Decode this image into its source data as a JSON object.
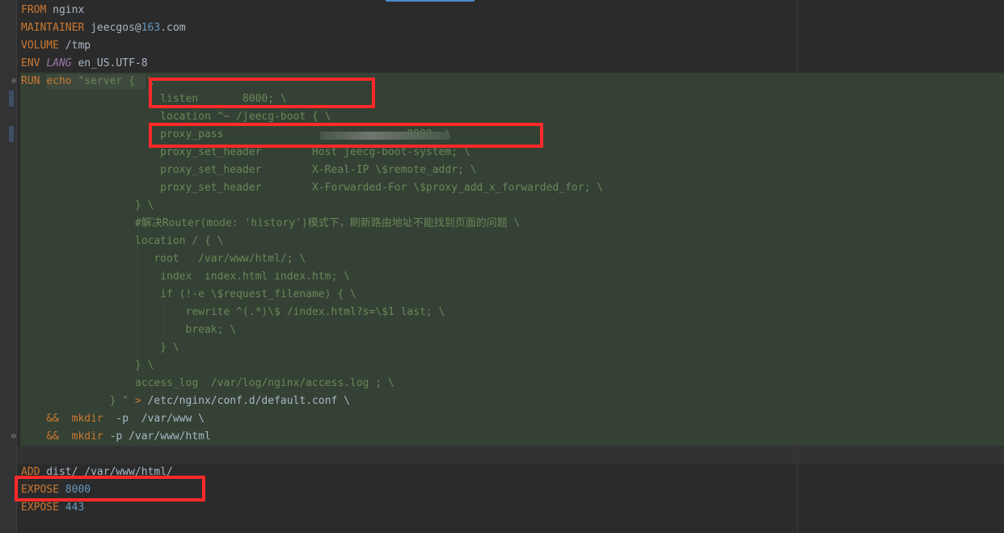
{
  "editor": {
    "lines": [
      {
        "t": [
          {
            "c": "kw",
            "v": "FROM"
          },
          {
            "c": "txt",
            "v": " nginx"
          }
        ]
      },
      {
        "t": [
          {
            "c": "kw",
            "v": "MAINTAINER"
          },
          {
            "c": "txt",
            "v": " jeecgos@"
          },
          {
            "c": "num",
            "v": "163"
          },
          {
            "c": "txt",
            "v": ".com"
          }
        ]
      },
      {
        "t": [
          {
            "c": "kw",
            "v": "VOLUME"
          },
          {
            "c": "txt",
            "v": " /tmp"
          }
        ]
      },
      {
        "t": [
          {
            "c": "kw",
            "v": "ENV"
          },
          {
            "c": "txt",
            "v": " "
          },
          {
            "c": "it",
            "v": "LANG"
          },
          {
            "c": "txt",
            "v": " en_US.UTF-8"
          }
        ]
      },
      {
        "t": [
          {
            "c": "kw",
            "v": "RUN"
          },
          {
            "c": "txt",
            "v": " "
          },
          {
            "c": "kw",
            "v": "echo"
          },
          {
            "c": "str",
            "v": " \"server {  \\"
          }
        ]
      },
      {
        "t": [
          {
            "c": "str",
            "v": "                      listen       8000; \\"
          }
        ]
      },
      {
        "t": [
          {
            "c": "str",
            "v": "                      location ^~ /jeecg-boot { \\"
          }
        ]
      },
      {
        "t": [
          {
            "c": "str",
            "v": "                      proxy_pass                            :9999; \\"
          }
        ]
      },
      {
        "t": [
          {
            "c": "str",
            "v": "                      proxy_set_header        Host jeecg-boot-system; \\"
          }
        ]
      },
      {
        "t": [
          {
            "c": "str",
            "v": "                      proxy_set_header        X-Real-IP \\$remote_addr; \\"
          }
        ]
      },
      {
        "t": [
          {
            "c": "str",
            "v": "                      proxy_set_header        X-Forwarded-For \\$proxy_add_x_forwarded_for; \\"
          }
        ]
      },
      {
        "t": [
          {
            "c": "str",
            "v": "                  } \\"
          }
        ]
      },
      {
        "t": [
          {
            "c": "str",
            "v": "                  #解决Router(mode: 'history')模式下，刷新路由地址不能找到页面的问题 \\"
          }
        ]
      },
      {
        "t": [
          {
            "c": "str",
            "v": "                  location / { \\"
          }
        ]
      },
      {
        "t": [
          {
            "c": "str",
            "v": "                     root   /var/www/html/; \\"
          }
        ]
      },
      {
        "t": [
          {
            "c": "str",
            "v": "                      index  index.html index.htm; \\"
          }
        ]
      },
      {
        "t": [
          {
            "c": "str",
            "v": "                      if (!-e \\$request_filename) { \\"
          }
        ]
      },
      {
        "t": [
          {
            "c": "str",
            "v": "                          rewrite ^(.*)\\$ /index.html?s=\\$1 last; \\"
          }
        ]
      },
      {
        "t": [
          {
            "c": "str",
            "v": "                          break; \\"
          }
        ]
      },
      {
        "t": [
          {
            "c": "str",
            "v": "                      } \\"
          }
        ]
      },
      {
        "t": [
          {
            "c": "str",
            "v": "                  } \\"
          }
        ]
      },
      {
        "t": [
          {
            "c": "str",
            "v": "                  access_log  /var/log/nginx/access.log ; \\"
          }
        ]
      },
      {
        "t": [
          {
            "c": "str",
            "v": "              } \" "
          },
          {
            "c": "kw",
            "v": ">"
          },
          {
            "c": "txt",
            "v": " /etc/nginx/conf.d/default.conf \\"
          }
        ]
      },
      {
        "t": [
          {
            "c": "txt",
            "v": "    "
          },
          {
            "c": "kw",
            "v": "&&"
          },
          {
            "c": "txt",
            "v": "  "
          },
          {
            "c": "kw",
            "v": "mkdir"
          },
          {
            "c": "txt",
            "v": "  -p  /var/www \\"
          }
        ]
      },
      {
        "t": [
          {
            "c": "txt",
            "v": "    "
          },
          {
            "c": "kw",
            "v": "&&"
          },
          {
            "c": "txt",
            "v": "  "
          },
          {
            "c": "kw",
            "v": "mkdir"
          },
          {
            "c": "txt",
            "v": " -p /var/www/html"
          }
        ]
      },
      {
        "t": []
      },
      {
        "t": [
          {
            "c": "kw",
            "v": "ADD"
          },
          {
            "c": "txt",
            "v": " dist/ /var/www/html/"
          }
        ]
      },
      {
        "t": [
          {
            "c": "kw",
            "v": "EXPOSE"
          },
          {
            "c": "txt",
            "v": " "
          },
          {
            "c": "num",
            "v": "8000"
          }
        ]
      },
      {
        "t": [
          {
            "c": "kw",
            "v": "EXPOSE"
          },
          {
            "c": "txt",
            "v": " "
          },
          {
            "c": "num",
            "v": "443"
          }
        ]
      }
    ]
  },
  "colors": {
    "keyword": "#cc7832",
    "string": "#6a8759",
    "number": "#6897bb",
    "annotation_box": "#ff2a2a"
  }
}
